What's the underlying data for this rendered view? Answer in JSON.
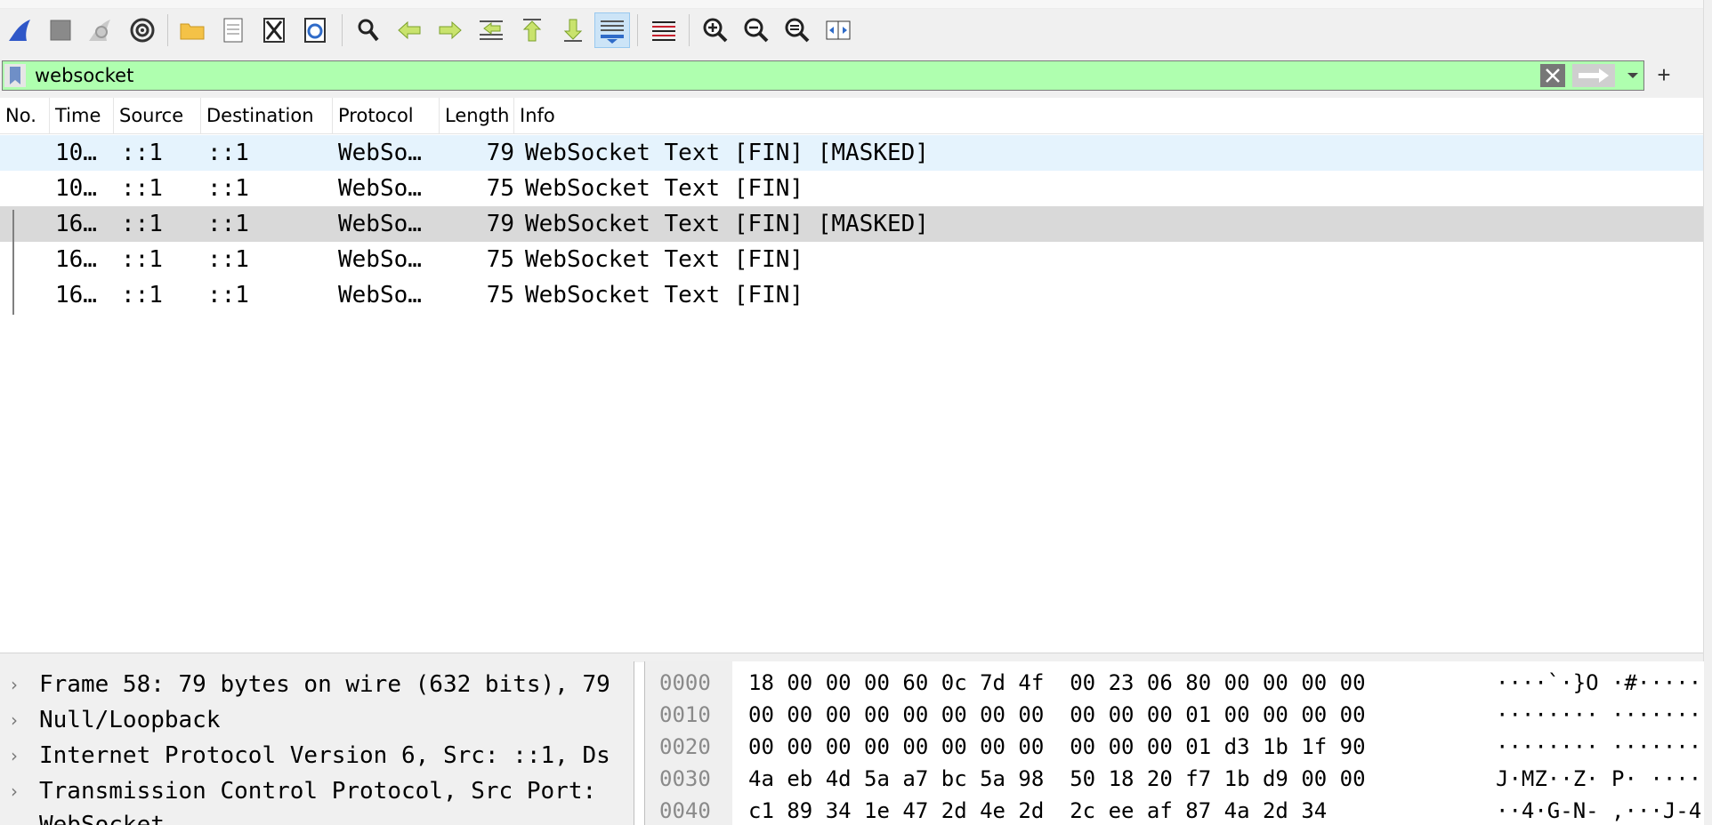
{
  "toolbar": {
    "icons": [
      "shark-fin-start-icon",
      "stop-square-icon",
      "restart-fin-icon",
      "capture-options-gear-icon",
      "open-folder-icon",
      "save-file-icon",
      "close-file-icon",
      "reload-icon",
      "find-magnifier-icon",
      "go-back-arrow-icon",
      "go-forward-arrow-icon",
      "go-to-packet-icon",
      "go-first-packet-icon",
      "go-last-packet-icon",
      "autoscroll-icon",
      "colorize-lines-icon",
      "zoom-in-icon",
      "zoom-out-icon",
      "zoom-normal-icon",
      "resize-columns-icon"
    ]
  },
  "filter": {
    "value": "websocket"
  },
  "packet_list": {
    "columns": [
      "No.",
      "Time",
      "Source",
      "Destination",
      "Protocol",
      "Length",
      "Info"
    ],
    "rows": [
      {
        "no": "",
        "time": "10…",
        "source": "::1",
        "destination": "::1",
        "protocol": "WebSo…",
        "length": "79",
        "info": "WebSocket Text [FIN] [MASKED]"
      },
      {
        "no": "",
        "time": "10…",
        "source": "::1",
        "destination": "::1",
        "protocol": "WebSo…",
        "length": "75",
        "info": "WebSocket Text [FIN]"
      },
      {
        "no": "",
        "time": "16…",
        "source": "::1",
        "destination": "::1",
        "protocol": "WebSo…",
        "length": "79",
        "info": "WebSocket Text [FIN] [MASKED]"
      },
      {
        "no": "",
        "time": "16…",
        "source": "::1",
        "destination": "::1",
        "protocol": "WebSo…",
        "length": "75",
        "info": "WebSocket Text [FIN]"
      },
      {
        "no": "",
        "time": "16…",
        "source": "::1",
        "destination": "::1",
        "protocol": "WebSo…",
        "length": "75",
        "info": "WebSocket Text [FIN]"
      }
    ]
  },
  "details": {
    "items": [
      {
        "label": "Frame 58: 79 bytes on wire (632 bits), 79",
        "expanded": false
      },
      {
        "label": "Null/Loopback",
        "expanded": false
      },
      {
        "label": "Internet Protocol Version 6, Src: ::1, Ds",
        "expanded": false
      },
      {
        "label": "Transmission Control Protocol, Src Port:",
        "expanded": false
      },
      {
        "label": "WebSocket",
        "expanded": true
      }
    ]
  },
  "bytes": {
    "rows": [
      {
        "offset": "0000",
        "hex": "18 00 00 00 60 0c 7d 4f  00 23 06 80 00 00 00 00",
        "ascii": "····`·}O ·#······"
      },
      {
        "offset": "0010",
        "hex": "00 00 00 00 00 00 00 00  00 00 00 01 00 00 00 00",
        "ascii": "········ ········"
      },
      {
        "offset": "0020",
        "hex": "00 00 00 00 00 00 00 00  00 00 00 01 d3 1b 1f 90",
        "ascii": "········ ········"
      },
      {
        "offset": "0030",
        "hex": "4a eb 4d 5a a7 bc 5a 98  50 18 20 f7 1b d9 00 00",
        "ascii": "J·MZ··Z· P· ·····"
      },
      {
        "offset": "0040",
        "hex": "c1 89 34 1e 47 2d 4e 2d  2c ee af 87 4a 2d 34",
        "ascii": "··4·G-N- ,···J-4"
      }
    ]
  },
  "colors": {
    "filter_valid": "#afffaf",
    "row_selected": "#e5f3fd",
    "row_related": "#d9d9d9"
  }
}
